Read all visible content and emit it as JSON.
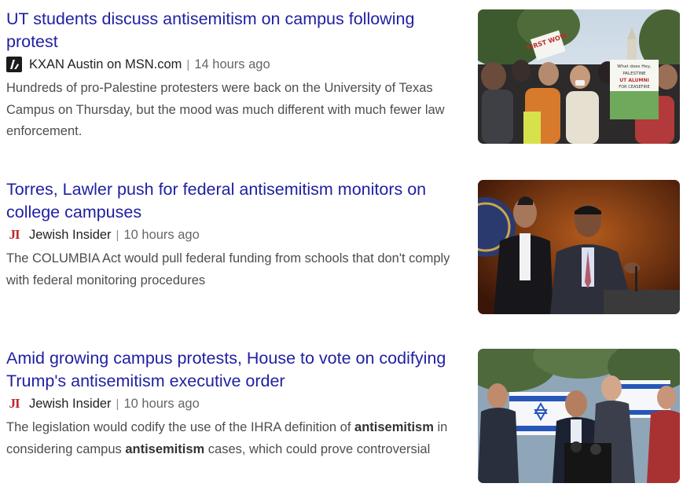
{
  "articles": [
    {
      "title": "UT students discuss antisemitism on campus following protest",
      "source": "KXAN Austin on MSN.com",
      "separator": "|",
      "time": "14 hours ago",
      "snippet_parts": [
        {
          "text": "Hundreds of pro-Palestine protesters were back on the University of Texas Campus on Thursday, but the mood was much different with much fewer law enforcement.",
          "bold": false
        }
      ],
      "logo": "msn-publisher-icon",
      "image": "protest-crowd-image"
    },
    {
      "title": "Torres, Lawler push for federal antisemitism monitors on college campuses",
      "source": "Jewish Insider",
      "separator": "|",
      "time": "10 hours ago",
      "logo_text": "JI",
      "snippet_parts": [
        {
          "text": "The COLUMBIA Act would pull federal funding from schools that don't comply with federal monitoring procedures",
          "bold": false
        }
      ],
      "logo": "jewish-insider-logo",
      "image": "congressmen-press-image"
    },
    {
      "title": "Amid growing campus protests, House to vote on codifying Trump's antisemitism executive order",
      "source": "Jewish Insider",
      "separator": "|",
      "time": "10 hours ago",
      "logo_text": "JI",
      "snippet_parts": [
        {
          "text": "The legislation would codify the use of the IHRA definition of ",
          "bold": false
        },
        {
          "text": "antisemitism",
          "bold": true
        },
        {
          "text": " in considering campus ",
          "bold": false
        },
        {
          "text": "antisemitism",
          "bold": true
        },
        {
          "text": " cases, which could prove controversial",
          "bold": false
        }
      ],
      "logo": "jewish-insider-logo",
      "image": "rally-israel-flags-image"
    }
  ],
  "image_text": {
    "sign_1": "FIRST WOW",
    "sign_2_line_1": "What does Hey,",
    "sign_2_line_2": "PALESTINE",
    "sign_2_line_3": "UT ALUMNI",
    "sign_2_line_4": "FOR CEASEFIRE"
  },
  "colors": {
    "title": "#1f1fa3",
    "source": "#222222",
    "time": "#666666",
    "snippet": "#4d4d4d",
    "ji_red": "#c0282d"
  }
}
